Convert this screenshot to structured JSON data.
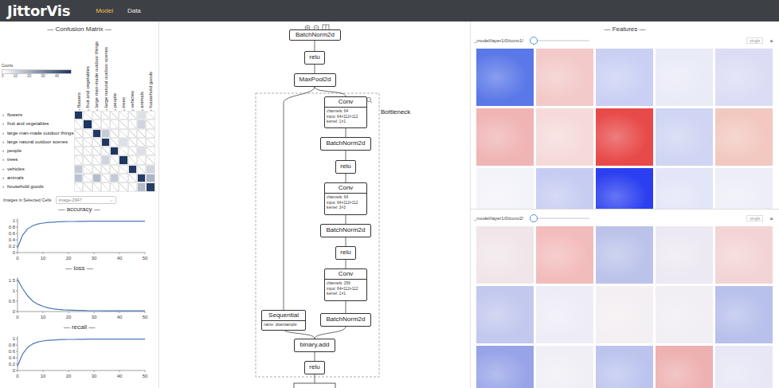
{
  "app": {
    "logo": "JittorVis"
  },
  "tabs": [
    {
      "label": "Model",
      "selected": true
    },
    {
      "label": "Data",
      "selected": false
    }
  ],
  "confusion": {
    "title": "— Confusion Matrix —",
    "legend": {
      "label": "Counts",
      "ticks": [
        "0",
        "10",
        "20",
        "30",
        "40"
      ]
    },
    "classes": [
      {
        "name": "flowers",
        "arrow": "›",
        "expanded": false
      },
      {
        "name": "fruit and vegetables",
        "arrow": "›",
        "expanded": false
      },
      {
        "name": "large man-made outdoor things",
        "arrow": "›",
        "expanded": false
      },
      {
        "name": "large natural outdoor scenes",
        "arrow": "›",
        "expanded": false
      },
      {
        "name": "people",
        "arrow": "›",
        "expanded": false
      },
      {
        "name": "trees",
        "arrow": "›",
        "expanded": false
      },
      {
        "name": "vehicles",
        "arrow": "›",
        "expanded": false
      },
      {
        "name": "animals",
        "arrow": "›",
        "expanded": false
      },
      {
        "name": "household goods",
        "arrow": "›",
        "expanded": false
      }
    ],
    "matrix": [
      [
        44,
        0,
        0,
        0,
        0,
        0,
        0,
        1,
        0
      ],
      [
        0,
        45,
        0,
        0,
        0,
        0,
        0,
        2,
        0
      ],
      [
        0,
        0,
        43,
        3,
        0,
        0,
        0,
        0,
        0
      ],
      [
        0,
        0,
        0,
        44,
        0,
        1,
        0,
        0,
        0
      ],
      [
        0,
        0,
        0,
        0,
        46,
        0,
        0,
        1,
        0
      ],
      [
        0,
        0,
        0,
        2,
        0,
        44,
        0,
        0,
        0
      ],
      [
        3,
        0,
        0,
        0,
        0,
        0,
        43,
        0,
        2
      ],
      [
        4,
        0,
        5,
        0,
        3,
        0,
        0,
        42,
        6
      ],
      [
        0,
        0,
        0,
        0,
        0,
        0,
        0,
        5,
        41
      ]
    ],
    "selector": {
      "label": "Images in Selected Cells",
      "value": "image-2947",
      "caret": "⌄"
    }
  },
  "charts": [
    {
      "title": "— accuracy —",
      "yTicks": [
        "1",
        "0.8",
        "0.6",
        "0.4",
        "0.2",
        "0"
      ],
      "xTicks": [
        "0",
        "10",
        "20",
        "30",
        "40",
        "50"
      ],
      "xMax": 50,
      "yMax": 1.08,
      "values": [
        0.15,
        0.55,
        0.75,
        0.85,
        0.9,
        0.93,
        0.95,
        0.96,
        0.97,
        0.975,
        0.98,
        0.98,
        0.985,
        0.985,
        0.99,
        0.99,
        0.99,
        0.99,
        0.99,
        0.99,
        0.99,
        0.99,
        0.99,
        0.99,
        0.99,
        0.99
      ]
    },
    {
      "title": "— loss —",
      "yTicks": [
        "1.5",
        "1",
        "0.5",
        "0"
      ],
      "xTicks": [
        "0",
        "10",
        "20",
        "30",
        "40",
        "50"
      ],
      "xMax": 50,
      "yMax": 1.65,
      "values": [
        1.55,
        1.1,
        0.75,
        0.5,
        0.35,
        0.25,
        0.18,
        0.13,
        0.1,
        0.08,
        0.07,
        0.06,
        0.05,
        0.05,
        0.04,
        0.04,
        0.04,
        0.03,
        0.03,
        0.03,
        0.03,
        0.03,
        0.03,
        0.03,
        0.03,
        0.03
      ]
    },
    {
      "title": "— recall —",
      "yTicks": [
        "1",
        "0.8",
        "0.6",
        "0.4",
        "0.2",
        "0"
      ],
      "xTicks": [
        "0",
        "10",
        "20",
        "30",
        "40",
        "50"
      ],
      "xMax": 50,
      "yMax": 1.08,
      "values": [
        0.14,
        0.52,
        0.73,
        0.84,
        0.9,
        0.93,
        0.95,
        0.96,
        0.97,
        0.975,
        0.98,
        0.98,
        0.985,
        0.985,
        0.99,
        0.99,
        0.99,
        0.99,
        0.99,
        0.99,
        0.99,
        0.99,
        0.99,
        0.99,
        0.99,
        0.99
      ]
    }
  ],
  "graph": {
    "groupLabel": "Bottleneck",
    "nodes": [
      {
        "label": "BatchNorm2d",
        "details": []
      },
      {
        "label": "relu",
        "details": []
      },
      {
        "label": "MaxPool2d",
        "details": []
      },
      {
        "label": "Conv",
        "details": [
          "channels: 64",
          "input: 64×112×112",
          "kernel: 1×1"
        ]
      },
      {
        "label": "BatchNorm2d",
        "details": []
      },
      {
        "label": "relu",
        "details": []
      },
      {
        "label": "Conv",
        "details": [
          "channels: 64",
          "input: 64×112×112",
          "kernel: 3×3"
        ]
      },
      {
        "label": "BatchNorm2d",
        "details": []
      },
      {
        "label": "relu",
        "details": []
      },
      {
        "label": "Conv",
        "details": [
          "channels: 256",
          "input: 64×112×112",
          "kernel: 1×1"
        ]
      },
      {
        "label": "BatchNorm2d",
        "details": []
      },
      {
        "label": "Sequential",
        "details": [
          "name: downsample"
        ]
      },
      {
        "label": "binary.add",
        "details": []
      },
      {
        "label": "relu",
        "details": []
      }
    ]
  },
  "features": {
    "title": "— Features —",
    "panels": [
      {
        "layer": "_model/layer1/0/conv1/",
        "level": 0,
        "mode": "single",
        "close": "×",
        "maps": [
          "#5a78e8",
          "#f3c9c9",
          "#c9d0f3",
          "#e9ebf7",
          "#dcdcf5",
          "#f0b4b4",
          "#f6dada",
          "#e84a4a",
          "#cfd5f3",
          "#f2c8c0",
          "#f3f3fa",
          "#c6ccf2",
          "#2b3ff0",
          "#e3e5f8",
          "#eeeef8"
        ]
      },
      {
        "layer": "_model/layer1/0/conv2/",
        "level": 0,
        "mode": "single",
        "close": "×",
        "maps": [
          "#f0e6ea",
          "#f3bcbc",
          "#bcc3ea",
          "#ede9f3",
          "#f3d4d4",
          "#c2c8ee",
          "#eeedf7",
          "#f4eff2",
          "#f1eef4",
          "#b8c0ec",
          "#97a4e8",
          "#f0eff6",
          "#bcc4ee",
          "#eeb0b0",
          "#e7e7f6"
        ]
      }
    ]
  }
}
